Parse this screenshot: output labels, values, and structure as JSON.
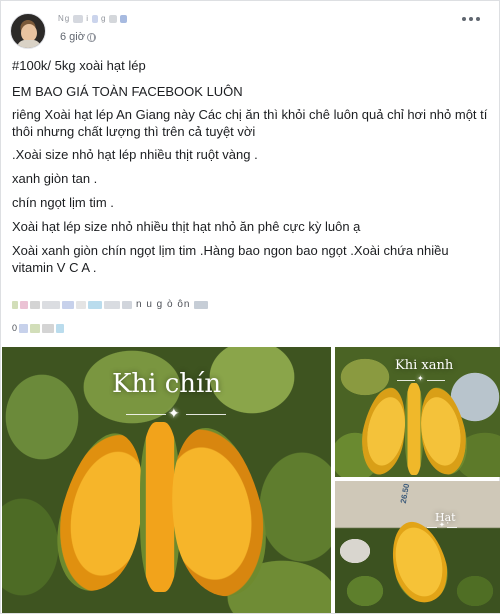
{
  "post": {
    "author": {
      "name_visible": "Ng",
      "name_fragment_2": "i",
      "name_fragment_3": "g"
    },
    "timestamp": "6 giờ",
    "tag_line": "#100k/ 5kg xoài hạt lép",
    "headline": "EM BAO GIÁ TOÀN FACEBOOK LUÔN",
    "intro": "riêng Xoài hạt lép An Giang này Các chị ăn thì khỏi chê luôn quả chỉ hơi nhỏ một tí thôi nhưng chất lượng thì trên cả tuyệt vời",
    "lines": [
      ".Xoài size nhỏ hạt lép nhiều thịt ruột vàng .",
      "xanh giòn tan .",
      "chín ngọt lịm tim .",
      "Xoài hạt lép size nhỏ nhiều thịt hạt nhỏ ăn phê cực kỳ luôn ạ",
      "Xoài xanh giòn chín ngọt lịm tim .Hàng bao ngon bao ngọt .Xoài chứa nhiều vitamin V C A ."
    ],
    "blurred_fragment": "n  u  g  ò  ôn",
    "blurred_fragment_2": "0"
  },
  "photos": [
    {
      "caption": "Khi chín"
    },
    {
      "caption": "Khi xanh"
    },
    {
      "caption": "Hạt",
      "box_label": "26.50"
    }
  ],
  "colors": {
    "mango_flesh": "#f2a31b",
    "mango_flesh_dark": "#d8860f",
    "mango_skin": "#6e8a2e",
    "blur_a": "#b9c6e6",
    "blur_b": "#c7d6a8",
    "blur_c": "#e6b3c9",
    "blur_d": "#a9d3e8"
  }
}
